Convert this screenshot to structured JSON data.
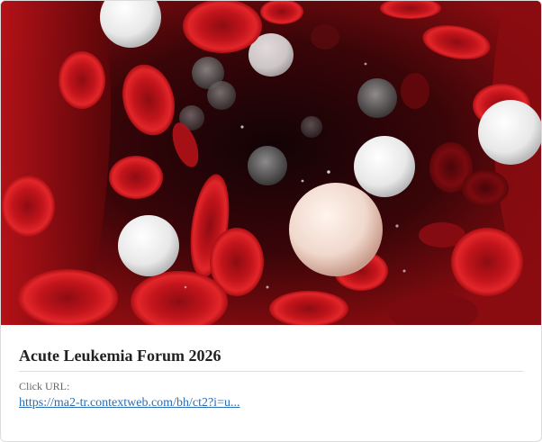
{
  "card": {
    "image_subject": "red and white blood cells in a blood vessel",
    "title": "Acute Leukemia Forum 2026",
    "click_label": "Click URL:",
    "click_url": "https://ma2-tr.contextweb.com/bh/ct2?i=u..."
  },
  "colors": {
    "title": "#222222",
    "label": "#666666",
    "link": "#2a6db5",
    "rbc": "#c8141c",
    "background": "#1a0606"
  }
}
